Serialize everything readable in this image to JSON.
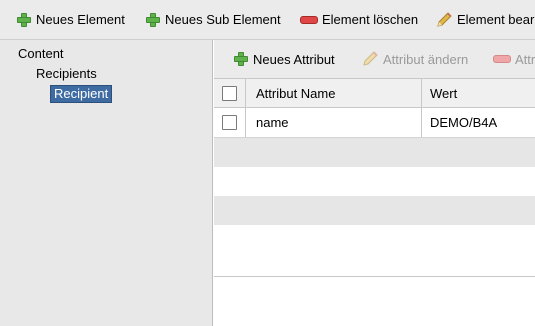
{
  "toolbar": {
    "new_element": "Neues Element",
    "new_sub_element": "Neues Sub Element",
    "delete_element": "Element löschen",
    "edit_element": "Element bear"
  },
  "tree": {
    "root": "Content",
    "child": "Recipients",
    "grandchild": "Recipient"
  },
  "attributes_toolbar": {
    "new_attribute": "Neues Attribut",
    "edit_attribute": "Attribut ändern",
    "delete_attribute": "Attri"
  },
  "attribute_table": {
    "columns": [
      "Attribut Name",
      "Wert"
    ],
    "rows": [
      {
        "name": "name",
        "value": "DEMO/B4A",
        "checked": false
      }
    ]
  },
  "colors": {
    "toolbar_bg": "#ebebeb",
    "selection": "#3f6ba3",
    "plus_icon": "#5fb14b",
    "minus_icon": "#e14646"
  }
}
